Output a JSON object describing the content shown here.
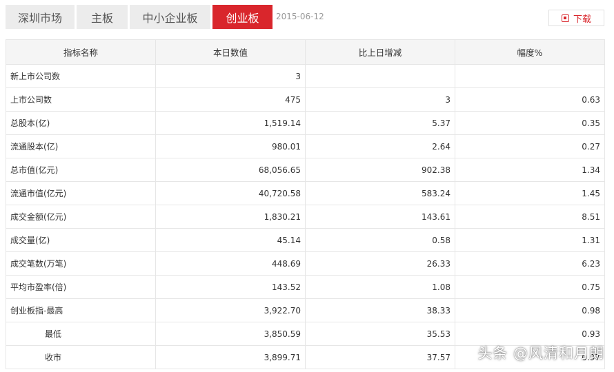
{
  "tabs": [
    {
      "label": "深圳市场",
      "active": false
    },
    {
      "label": "主板",
      "active": false
    },
    {
      "label": "中小企业板",
      "active": false
    },
    {
      "label": "创业板",
      "active": true
    }
  ],
  "date": "2015-06-12",
  "download_label": "下载",
  "table": {
    "headers": [
      "指标名称",
      "本日数值",
      "比上日增减",
      "幅度%"
    ],
    "rows": [
      {
        "name": "新上市公司数",
        "value": "3",
        "change": "",
        "pct": ""
      },
      {
        "name": "上市公司数",
        "value": "475",
        "change": "3",
        "pct": "0.63"
      },
      {
        "name": "总股本(亿)",
        "value": "1,519.14",
        "change": "5.37",
        "pct": "0.35"
      },
      {
        "name": "流通股本(亿)",
        "value": "980.01",
        "change": "2.64",
        "pct": "0.27"
      },
      {
        "name": "总市值(亿元)",
        "value": "68,056.65",
        "change": "902.38",
        "pct": "1.34"
      },
      {
        "name": "流通市值(亿元)",
        "value": "40,720.58",
        "change": "583.24",
        "pct": "1.45"
      },
      {
        "name": "成交金额(亿元)",
        "value": "1,830.21",
        "change": "143.61",
        "pct": "8.51"
      },
      {
        "name": "成交量(亿)",
        "value": "45.14",
        "change": "0.58",
        "pct": "1.31"
      },
      {
        "name": "成交笔数(万笔)",
        "value": "448.69",
        "change": "26.33",
        "pct": "6.23"
      },
      {
        "name": "平均市盈率(倍)",
        "value": "143.52",
        "change": "1.08",
        "pct": "0.75"
      },
      {
        "name": "创业板指-最高",
        "value": "3,922.70",
        "change": "38.33",
        "pct": "0.98"
      },
      {
        "name": "最低",
        "value": "3,850.59",
        "change": "35.53",
        "pct": "0.93"
      },
      {
        "name": "收市",
        "value": "3,899.71",
        "change": "37.57",
        "pct": "0.97"
      }
    ]
  },
  "watermark": "头条 @风清和月朗"
}
